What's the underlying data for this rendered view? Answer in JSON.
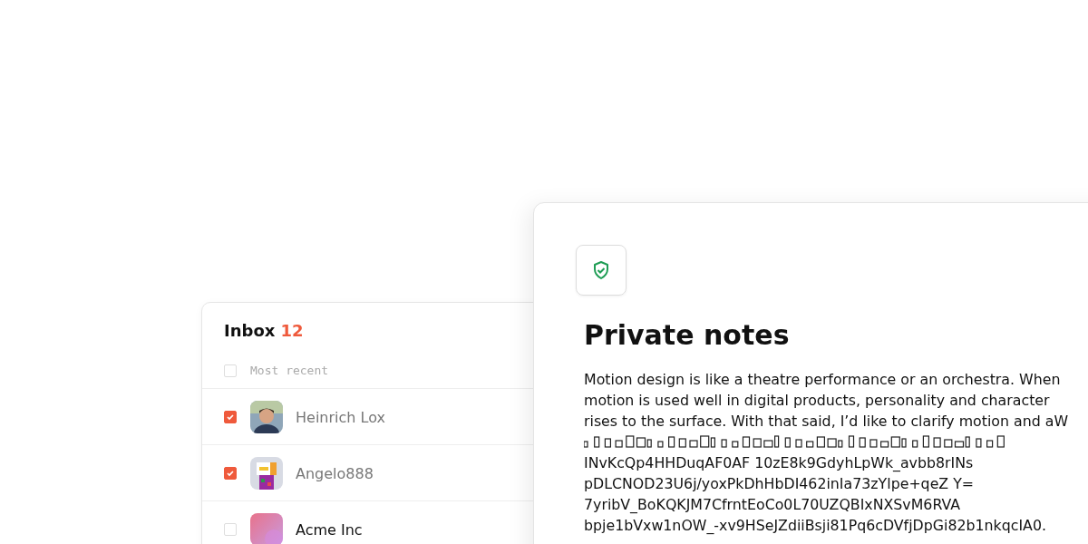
{
  "inbox": {
    "title": "Inbox",
    "count": "12",
    "filter": {
      "label": "Most recent",
      "checked": false
    },
    "rows": [
      {
        "name": "Heinrich Lox",
        "checked": true,
        "read": true
      },
      {
        "name": "Angelo888",
        "checked": true,
        "read": true
      },
      {
        "name": "Acme Inc",
        "checked": false,
        "read": false
      }
    ]
  },
  "notes": {
    "title": "Private notes",
    "lines": [
      {
        "kind": "text",
        "text": "Motion design is like a theatre performance or an orchestra. When"
      },
      {
        "kind": "text",
        "text": "motion is used well in digital products, personality and character"
      },
      {
        "kind": "text",
        "text": "rises to the surface. With that said, I’d like to clarify motion and aW"
      },
      {
        "kind": "scrambled"
      },
      {
        "kind": "text",
        "text": "INvKcQp4HHDuqAF0AF 10zE8k9GdyhLpWk_avbb8rINs"
      },
      {
        "kind": "text",
        "text": "pDLCNOD23U6j/yoxPkDhHbDI462inIa73zYlpe+qeZ Y="
      },
      {
        "kind": "text",
        "text": "7yribV_BoKQKJM7CfrntEoCo0L70UZQBIxNXSvM6RVA"
      },
      {
        "kind": "text",
        "text": "bpje1bVxw1nOW_-xv9HSeJZdiiBsji81Pq6cDVfjDpGi82b1nkqcIA0."
      }
    ]
  }
}
